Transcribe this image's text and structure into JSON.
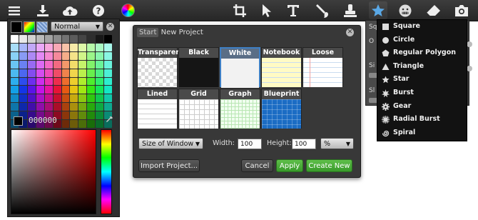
{
  "toolbar": {
    "items": [
      "menu-icon",
      "download-icon",
      "cloud-upload-icon",
      "help-icon",
      "color-wheel-icon",
      "crop-icon",
      "pointer-icon",
      "text-icon",
      "brush-icon",
      "stamp-icon",
      "star-icon",
      "face-icon",
      "eraser-icon",
      "camera-icon"
    ],
    "active": "star-icon"
  },
  "color_panel": {
    "blend_mode": "Normal",
    "hex_value": "000000",
    "colors": [
      "#000000",
      "#2b2b2b",
      "#555555",
      "#808080",
      "#aaaaaa",
      "#d4d4d4",
      "#ffffff"
    ]
  },
  "dialog": {
    "breadcrumb_start": "Start",
    "breadcrumb_current": "New Project",
    "templates": [
      {
        "label": "Transparent"
      },
      {
        "label": "Black"
      },
      {
        "label": "White"
      },
      {
        "label": "Notebook"
      },
      {
        "label": "Loose Leaf"
      },
      {
        "label": "Lined"
      },
      {
        "label": "Grid"
      },
      {
        "label": "Graph Paper"
      },
      {
        "label": "Blueprint"
      }
    ],
    "selected_template": "White",
    "size_select": "Size of Window",
    "width_label": "Width:",
    "width_value": "100",
    "height_label": "Height:",
    "height_value": "100",
    "unit_select": "%",
    "import_button": "Import Project...",
    "cancel_button": "Cancel",
    "apply_button": "Apply",
    "create_button": "Create New"
  },
  "shape_panel": {
    "partial_labels": [
      "Sq",
      "O",
      "Si",
      "Sl"
    ]
  },
  "shape_menu": {
    "items": [
      {
        "label": "Square",
        "icon": "square-icon"
      },
      {
        "label": "Circle",
        "icon": "circle-icon"
      },
      {
        "label": "Regular Polygon",
        "icon": "polygon-icon"
      },
      {
        "label": "Triangle",
        "icon": "triangle-icon"
      },
      {
        "label": "Star",
        "icon": "star-icon"
      },
      {
        "label": "Burst",
        "icon": "burst-icon"
      },
      {
        "label": "Gear",
        "icon": "gear-icon"
      },
      {
        "label": "Radial Burst",
        "icon": "radial-burst-icon"
      },
      {
        "label": "Spiral",
        "icon": "spiral-icon"
      }
    ]
  }
}
